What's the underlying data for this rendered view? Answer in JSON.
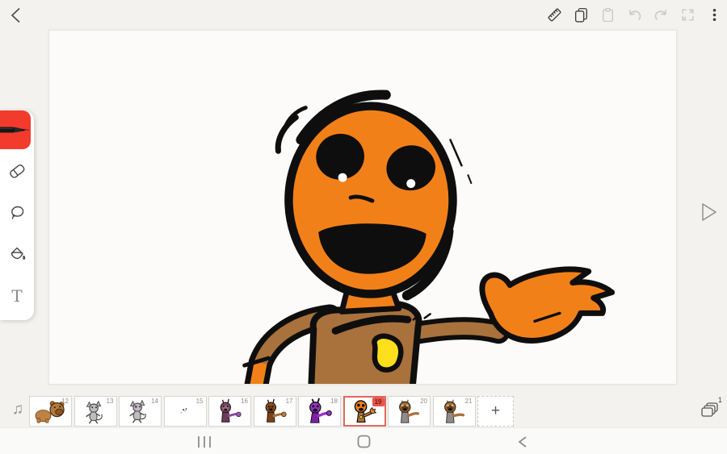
{
  "topbar": {
    "back": {
      "icon": "back-chevron"
    },
    "actions": [
      {
        "name": "ruler",
        "enabled": true
      },
      {
        "name": "copy",
        "enabled": true
      },
      {
        "name": "paste",
        "enabled": false
      },
      {
        "name": "undo",
        "enabled": false
      },
      {
        "name": "redo",
        "enabled": false
      },
      {
        "name": "fullscreen",
        "enabled": false
      },
      {
        "name": "more-options",
        "enabled": true
      }
    ]
  },
  "toolbar": {
    "selected_tool": "pen",
    "selected_tool_color": "#f23b2d",
    "tools": [
      "pen",
      "eraser",
      "lasso",
      "fill",
      "text"
    ],
    "text_tool_glyph": "T"
  },
  "canvas": {
    "colors": {
      "background": "#fcfbf9",
      "character_skin": "#f28019",
      "character_shirt": "#a9713c",
      "badge": "#ffdf1b",
      "outline": "#0e0e0e"
    }
  },
  "playback": {
    "control": "play"
  },
  "timeline": {
    "frames": [
      {
        "number": "12",
        "selected": false
      },
      {
        "number": "13",
        "selected": false
      },
      {
        "number": "14",
        "selected": false
      },
      {
        "number": "15",
        "selected": false
      },
      {
        "number": "16",
        "selected": false
      },
      {
        "number": "17",
        "selected": false
      },
      {
        "number": "18",
        "selected": false
      },
      {
        "number": "19",
        "selected": true
      },
      {
        "number": "20",
        "selected": false
      },
      {
        "number": "21",
        "selected": false
      }
    ],
    "selected_frame_badge": "19",
    "add_button": "+",
    "layers_count": "1"
  },
  "icons": {
    "music": "♫"
  },
  "navbar": {
    "buttons": [
      "recents",
      "home",
      "back"
    ]
  }
}
